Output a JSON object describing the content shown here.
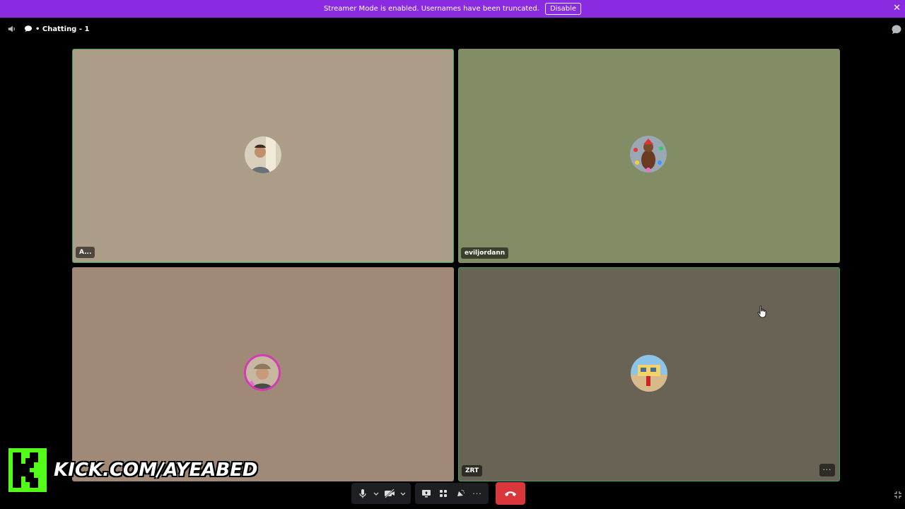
{
  "banner": {
    "message": "Streamer Mode is enabled. Usernames have been truncated.",
    "disable_label": "Disable",
    "close_glyph": "✕"
  },
  "topbar": {
    "channel_name": "• Chatting - 1"
  },
  "tiles": [
    {
      "name_label": "A...",
      "avatar": "avatar-man-selfie",
      "bg": "#ab9d87",
      "speaking": true
    },
    {
      "name_label": "eviljordann",
      "avatar": "avatar-holiday-figure",
      "bg": "#838d65",
      "speaking": false
    },
    {
      "name_label": "",
      "avatar": "avatar-pink-ring",
      "bg": "#a18978",
      "speaking": false
    },
    {
      "name_label": "ZRT",
      "avatar": "avatar-beach",
      "bg": "#686354",
      "speaking": true
    }
  ],
  "tile_more_glyph": "···",
  "controls": {
    "more_glyph": "···"
  },
  "overlay": {
    "kick_url": "KICK.COM/AYEABED"
  },
  "colors": {
    "banner": "#8a2be2",
    "speaking_border": "#3ba55d",
    "hangup": "#da373c",
    "kick_green": "#53fc18"
  }
}
